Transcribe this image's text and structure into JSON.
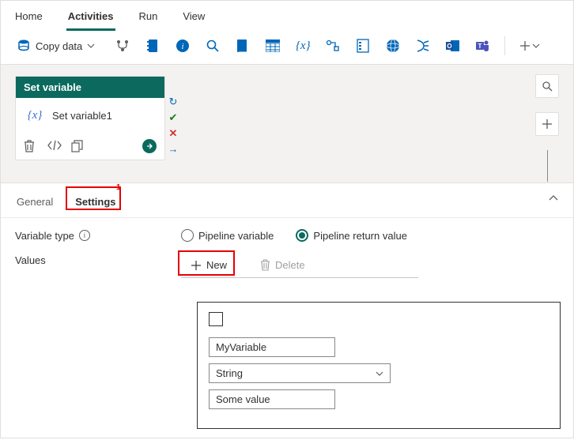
{
  "topnav": {
    "items": [
      "Home",
      "Activities",
      "Run",
      "View"
    ],
    "active_index": 1
  },
  "toolbar": {
    "copy_data_label": "Copy data"
  },
  "activity": {
    "header": "Set variable",
    "name": "Set variable1"
  },
  "pane_tabs": {
    "general": "General",
    "settings": "Settings",
    "active": "settings"
  },
  "annotations": {
    "settings_num": "1"
  },
  "labels": {
    "variable_type": "Variable type",
    "values": "Values"
  },
  "radios": {
    "pipeline_variable": "Pipeline variable",
    "pipeline_return_value": "Pipeline return value",
    "selected": "pipeline_return_value"
  },
  "buttons": {
    "new": "New",
    "delete": "Delete"
  },
  "value_card": {
    "name": "MyVariable",
    "type": "String",
    "value": "Some value"
  }
}
